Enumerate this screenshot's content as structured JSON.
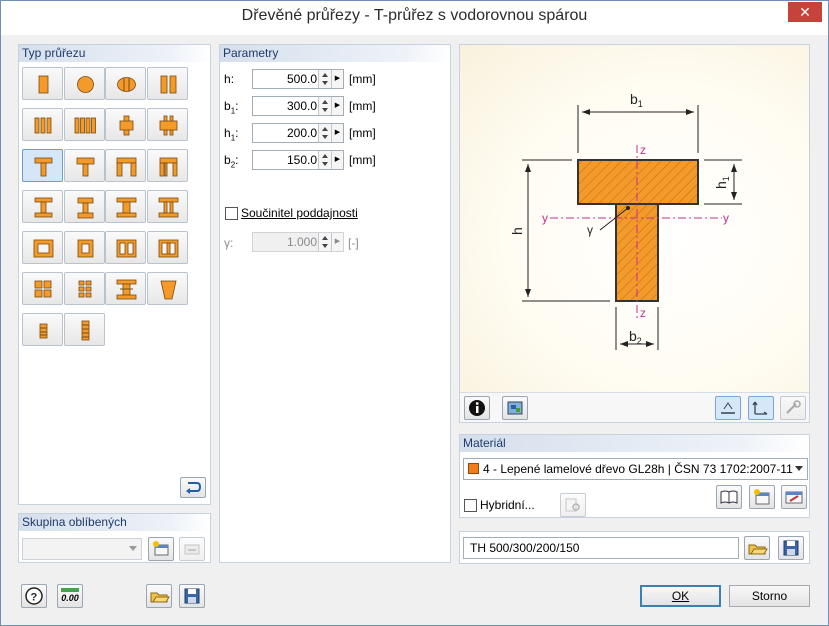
{
  "window": {
    "title": "Dřevěné průřezy - T-průřez s vodorovnou spárou",
    "close_glyph": "✕"
  },
  "type_panel": {
    "header": "Typ průřezu"
  },
  "favorites": {
    "header": "Skupina oblíbených",
    "value": ""
  },
  "params": {
    "header": "Parametry",
    "rows": [
      {
        "label": "h",
        "sub": "",
        "value": "500.0",
        "unit": "[mm]"
      },
      {
        "label": "b",
        "sub": "1",
        "value": "300.0",
        "unit": "[mm]"
      },
      {
        "label": "h",
        "sub": "1",
        "value": "200.0",
        "unit": "[mm]"
      },
      {
        "label": "b",
        "sub": "2",
        "value": "150.0",
        "unit": "[mm]"
      }
    ],
    "coef_label": "Součinitel poddajnosti",
    "coef_checked": false,
    "gamma_label": "γ:",
    "gamma_value": "1.000",
    "gamma_unit": "[-]"
  },
  "drawing": {
    "labels": {
      "b1": "b",
      "b1_sub": "1",
      "h": "h",
      "h1": "h",
      "h1_sub": "1",
      "b2": "b",
      "b2_sub": "2",
      "y": "y",
      "z": "z",
      "gamma": "γ"
    }
  },
  "material": {
    "header": "Materiál",
    "value": "4 - Lepené lamelové dřevo GL28h | ČSN 73 1702:2007-11",
    "color": "#f07d17",
    "hybrid_label": "Hybridní..."
  },
  "section_name": "TH 500/300/200/150",
  "buttons": {
    "ok": "OK",
    "cancel": "Storno",
    "decimal": "0.00"
  },
  "colors": {
    "timber": "#f39a2a",
    "axis": "#c2338c",
    "accent": "#3c7fb1"
  }
}
